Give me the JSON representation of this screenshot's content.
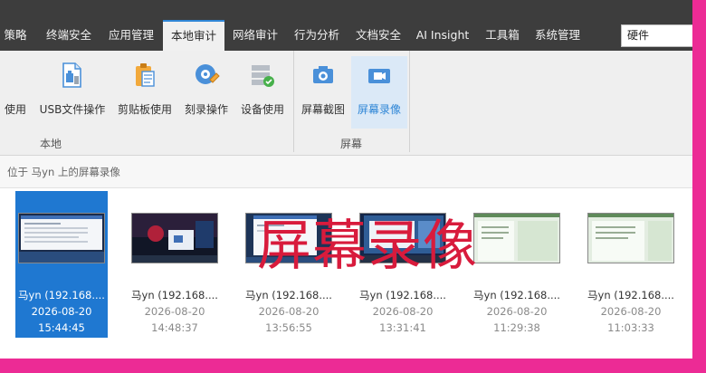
{
  "nav": {
    "tabs": [
      {
        "label": "策略",
        "active": false
      },
      {
        "label": "终端安全",
        "active": false
      },
      {
        "label": "应用管理",
        "active": false
      },
      {
        "label": "本地审计",
        "active": true
      },
      {
        "label": "网络审计",
        "active": false
      },
      {
        "label": "行为分析",
        "active": false
      },
      {
        "label": "文档安全",
        "active": false
      },
      {
        "label": "AI Insight",
        "active": false
      },
      {
        "label": "工具箱",
        "active": false
      },
      {
        "label": "系统管理",
        "active": false
      }
    ],
    "search_value": "硬件"
  },
  "ribbon": {
    "buttons": [
      {
        "label": "使用",
        "icon": "device-usage-icon"
      },
      {
        "label": "USB文件操作",
        "icon": "usb-file-icon"
      },
      {
        "label": "剪贴板使用",
        "icon": "clipboard-icon"
      },
      {
        "label": "刻录操作",
        "icon": "disc-burn-icon"
      },
      {
        "label": "设备使用",
        "icon": "device-check-icon"
      },
      {
        "label": "屏幕截图",
        "icon": "camera-icon"
      },
      {
        "label": "屏幕录像",
        "icon": "video-icon",
        "selected": true
      }
    ],
    "groups": {
      "local": "本地",
      "screen": "屏幕"
    }
  },
  "breadcrumb": "位于 马yn 上的屏幕录像",
  "recordings": [
    {
      "name": "马yn (192.168....",
      "date": "2026-08-20",
      "time": "15:44:45",
      "selected": true
    },
    {
      "name": "马yn (192.168....",
      "date": "2026-08-20",
      "time": "14:48:37",
      "selected": false
    },
    {
      "name": "马yn (192.168....",
      "date": "2026-08-20",
      "time": "13:56:55",
      "selected": false
    },
    {
      "name": "马yn (192.168....",
      "date": "2026-08-20",
      "time": "13:31:41",
      "selected": false
    },
    {
      "name": "马yn (192.168....",
      "date": "2026-08-20",
      "time": "11:29:38",
      "selected": false
    },
    {
      "name": "马yn (192.168....",
      "date": "2026-08-20",
      "time": "11:03:33",
      "selected": false
    }
  ],
  "overlay_text": "屏幕录像",
  "colors": {
    "accent": "#2f86d6",
    "selected_card": "#1f78d1",
    "overlay": "#d81b3c",
    "frame": "#ec2b95",
    "nav_bg": "#3d3d3d"
  }
}
